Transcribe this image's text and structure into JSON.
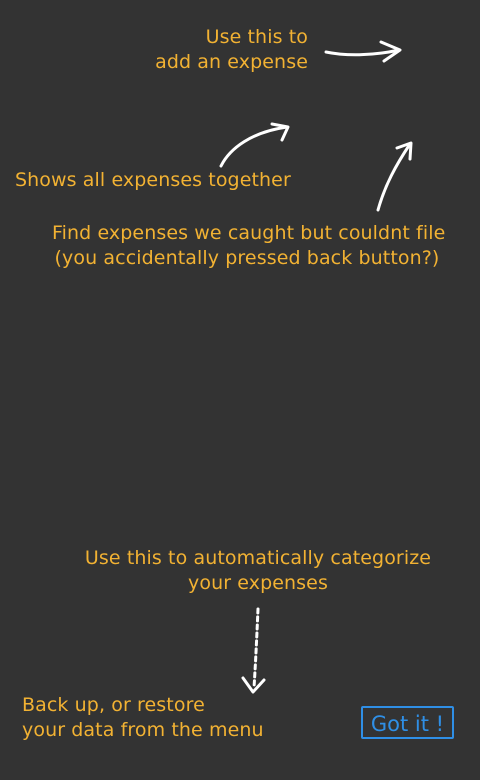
{
  "hints": {
    "add_expense": {
      "line1": "Use this to",
      "line2": "add an expense"
    },
    "all_expenses": {
      "line1": "Shows all expenses together"
    },
    "unfiled": {
      "line1": "Find expenses we caught but couldnt file",
      "line2": "(you accidentally pressed back button?)"
    },
    "categorize": {
      "line1": "Use this to automatically categorize",
      "line2": "your expenses"
    },
    "backup": {
      "line1": "Back up, or restore",
      "line2": "your data from the menu"
    }
  },
  "dismiss_button": {
    "label": "Got it !"
  },
  "colors": {
    "background": "#333333",
    "hint_text": "#f2b233",
    "arrows": "#ffffff",
    "button": "#2f8fe6"
  }
}
